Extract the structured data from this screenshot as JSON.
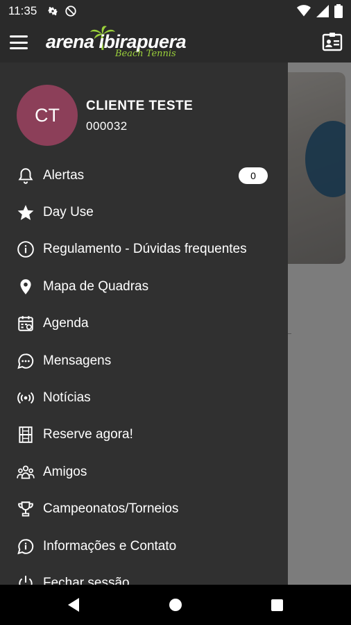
{
  "status_bar": {
    "time": "11:35"
  },
  "app_bar": {
    "logo_word": "arena ibirapuera",
    "logo_tagline": "Beach Tennis"
  },
  "drawer": {
    "avatar_initials": "CT",
    "user_name": "CLIENTE TESTE",
    "user_code": "000032",
    "items": [
      {
        "label": "Alertas",
        "icon": "bell-icon",
        "badge": "0"
      },
      {
        "label": "Day Use",
        "icon": "star-icon"
      },
      {
        "label": "Regulamento - Dúvidas frequentes",
        "icon": "info-icon"
      },
      {
        "label": "Mapa de Quadras",
        "icon": "map-pin-icon"
      },
      {
        "label": "Agenda",
        "icon": "calendar-icon"
      },
      {
        "label": "Mensagens",
        "icon": "chat-icon"
      },
      {
        "label": "Notícias",
        "icon": "broadcast-icon"
      },
      {
        "label": "Reserve agora!",
        "icon": "court-icon"
      },
      {
        "label": "Amigos",
        "icon": "friends-icon"
      },
      {
        "label": "Campeonatos/Torneios",
        "icon": "trophy-icon"
      },
      {
        "label": "Informações e Contato",
        "icon": "info-chat-icon"
      },
      {
        "label": "Fechar sessão",
        "icon": "power-icon"
      }
    ]
  },
  "colors": {
    "drawer_bg": "#303030",
    "avatar_bg": "#8c3f59",
    "logo_accent": "#9bd13b"
  }
}
